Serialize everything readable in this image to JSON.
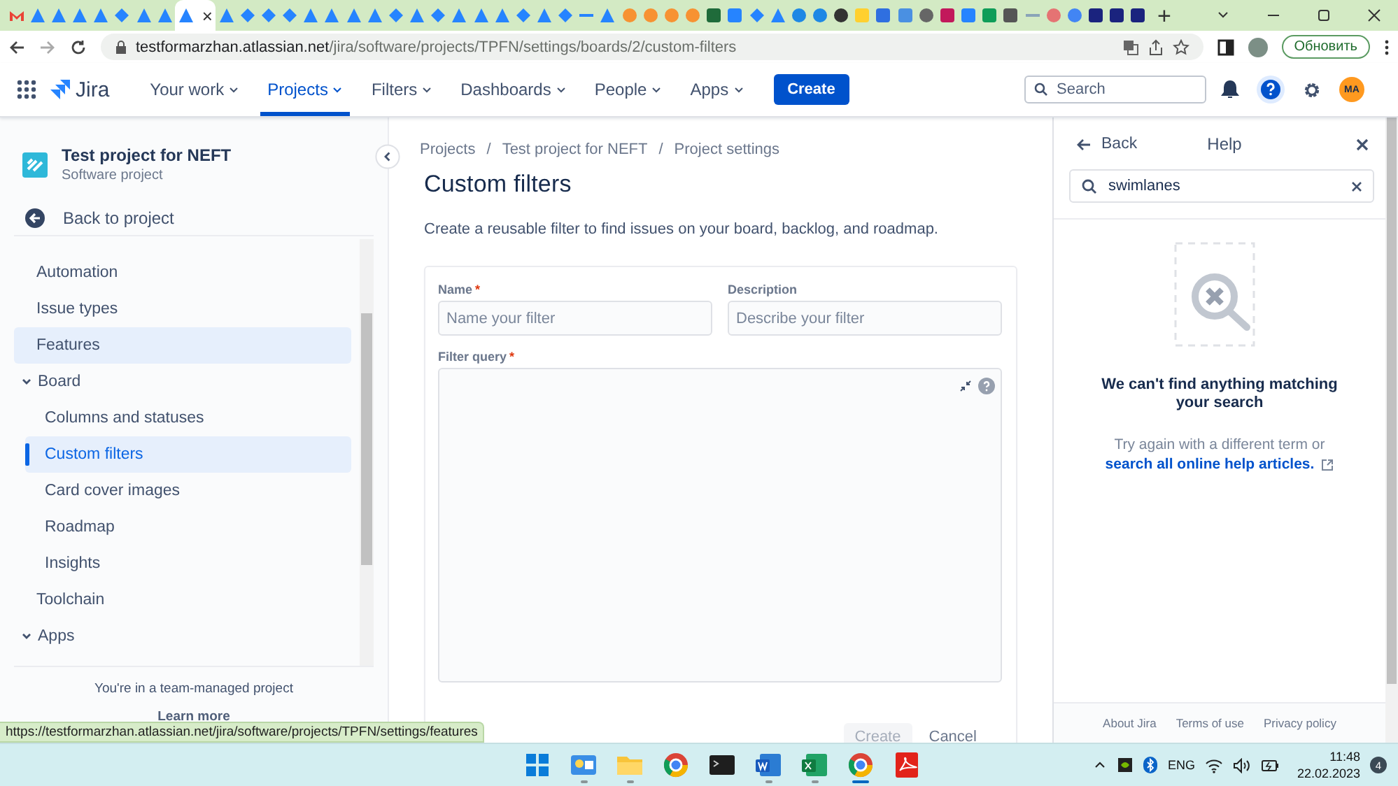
{
  "browser": {
    "tabs": [
      {
        "kind": "gmail",
        "color": "#ea4335",
        "selected": false
      },
      {
        "kind": "triangle",
        "color": "#2684ff",
        "selected": false
      },
      {
        "kind": "triangle",
        "color": "#2684ff",
        "selected": false
      },
      {
        "kind": "triangle",
        "color": "#2684ff",
        "selected": false
      },
      {
        "kind": "triangle",
        "color": "#2684ff",
        "selected": false
      },
      {
        "kind": "arrows",
        "color": "#2684ff",
        "selected": false
      },
      {
        "kind": "triangle",
        "color": "#2684ff",
        "selected": false
      },
      {
        "kind": "triangle",
        "color": "#2684ff",
        "selected": false
      },
      {
        "kind": "triangle",
        "color": "#2684ff",
        "selected": true,
        "close": "×"
      },
      {
        "kind": "triangle",
        "color": "#2684ff",
        "selected": false
      },
      {
        "kind": "arrows",
        "color": "#2684ff",
        "selected": false
      },
      {
        "kind": "arrows",
        "color": "#2684ff",
        "selected": false
      },
      {
        "kind": "arrows",
        "color": "#2684ff",
        "selected": false
      },
      {
        "kind": "triangle",
        "color": "#2684ff",
        "selected": false
      },
      {
        "kind": "triangle",
        "color": "#2684ff",
        "selected": false
      },
      {
        "kind": "triangle",
        "color": "#2684ff",
        "selected": false
      },
      {
        "kind": "triangle",
        "color": "#2684ff",
        "selected": false
      },
      {
        "kind": "arrows",
        "color": "#2684ff",
        "selected": false
      },
      {
        "kind": "triangle",
        "color": "#2684ff",
        "selected": false
      },
      {
        "kind": "arrows",
        "color": "#2684ff",
        "selected": false
      },
      {
        "kind": "triangle",
        "color": "#2684ff",
        "selected": false
      },
      {
        "kind": "triangle",
        "color": "#2684ff",
        "selected": false
      },
      {
        "kind": "triangle",
        "color": "#2684ff",
        "selected": false
      },
      {
        "kind": "arrows",
        "color": "#2684ff",
        "selected": false
      },
      {
        "kind": "triangle",
        "color": "#2684ff",
        "selected": false
      },
      {
        "kind": "arrows",
        "color": "#2684ff",
        "selected": false
      },
      {
        "kind": "line",
        "color": "#2684ff",
        "selected": false
      },
      {
        "kind": "triangle",
        "color": "#2684ff",
        "selected": false
      },
      {
        "kind": "circle",
        "color": "#f79232",
        "selected": false
      },
      {
        "kind": "circle",
        "color": "#f79232",
        "selected": false
      },
      {
        "kind": "circle",
        "color": "#f79232",
        "selected": false
      },
      {
        "kind": "circle",
        "color": "#f79232",
        "selected": false
      },
      {
        "kind": "square",
        "color": "#1f6b3a",
        "selected": false
      },
      {
        "kind": "square",
        "color": "#2684ff",
        "selected": false
      },
      {
        "kind": "arrows",
        "color": "#2684ff",
        "selected": false
      },
      {
        "kind": "triangle",
        "color": "#2684ff",
        "selected": false
      },
      {
        "kind": "circle",
        "color": "#1e88e5",
        "selected": false
      },
      {
        "kind": "circle",
        "color": "#1e88e5",
        "selected": false
      },
      {
        "kind": "circle",
        "color": "#333333",
        "selected": false
      },
      {
        "kind": "square",
        "color": "#ffd02f",
        "selected": false
      },
      {
        "kind": "square",
        "color": "#2f6fe0",
        "selected": false
      },
      {
        "kind": "square",
        "color": "#4a90e2",
        "selected": false
      },
      {
        "kind": "circle",
        "color": "#666666",
        "selected": false
      },
      {
        "kind": "square",
        "color": "#c2185b",
        "selected": false
      },
      {
        "kind": "square",
        "color": "#2684ff",
        "selected": false
      },
      {
        "kind": "square",
        "color": "#0f9d58",
        "selected": false
      },
      {
        "kind": "square",
        "color": "#555555",
        "selected": false
      },
      {
        "kind": "line",
        "color": "#8aa4b8",
        "selected": false
      },
      {
        "kind": "circle",
        "color": "#e57373",
        "selected": false
      },
      {
        "kind": "circle",
        "color": "#4285f4",
        "selected": false
      },
      {
        "kind": "square",
        "color": "#1a237e",
        "selected": false
      },
      {
        "kind": "square",
        "color": "#1a237e",
        "selected": false
      },
      {
        "kind": "square",
        "color": "#1a237e",
        "selected": false
      }
    ],
    "new_tab": "+",
    "url_host": "testformarzhan.atlassian.net",
    "url_path": "/jira/software/projects/TPFN/settings/boards/2/custom-filters",
    "update_button": "Обновить",
    "status_url": "https://testformarzhan.atlassian.net/jira/software/projects/TPFN/settings/features"
  },
  "nav": {
    "product": "Jira",
    "menu": [
      {
        "label": "Your work",
        "selected": false
      },
      {
        "label": "Projects",
        "selected": true
      },
      {
        "label": "Filters",
        "selected": false
      },
      {
        "label": "Dashboards",
        "selected": false
      },
      {
        "label": "People",
        "selected": false
      },
      {
        "label": "Apps",
        "selected": false
      }
    ],
    "create": "Create",
    "search_placeholder": "Search",
    "help_open": true,
    "avatar": "MA"
  },
  "sidebar": {
    "project_name": "Test project for NEFT",
    "project_type": "Software project",
    "back": "Back to project",
    "items": [
      {
        "label": "Automation",
        "selected": false,
        "highlighted": false
      },
      {
        "label": "Issue types",
        "selected": false,
        "highlighted": false
      },
      {
        "label": "Features",
        "selected": false,
        "highlighted": true
      },
      {
        "label": "Board",
        "selected": false,
        "highlighted": false,
        "expanded": true,
        "children": [
          {
            "label": "Columns and statuses",
            "selected": false,
            "highlighted": false
          },
          {
            "label": "Custom filters",
            "selected": true,
            "highlighted": false
          },
          {
            "label": "Card cover images",
            "selected": false,
            "highlighted": false
          },
          {
            "label": "Roadmap",
            "selected": false,
            "highlighted": false
          },
          {
            "label": "Insights",
            "selected": false,
            "highlighted": false
          }
        ]
      },
      {
        "label": "Toolchain",
        "selected": false,
        "highlighted": false
      },
      {
        "label": "Apps",
        "selected": false,
        "highlighted": false,
        "expanded": true
      }
    ],
    "footer_note": "You're in a team-managed project",
    "footer_link": "Learn more"
  },
  "main": {
    "breadcrumbs": [
      "Projects",
      "Test project for NEFT",
      "Project settings"
    ],
    "breadcrumb_separator": "/",
    "title": "Custom filters",
    "description": "Create a reusable filter to find issues on your board, backlog, and roadmap.",
    "fields": [
      {
        "kind": "input",
        "label": "Name",
        "required": "*",
        "placeholder": "Name your filter"
      },
      {
        "kind": "input",
        "label": "Description",
        "placeholder": "Describe your filter"
      },
      {
        "kind": "query",
        "label": "Filter query",
        "required": "*"
      }
    ],
    "buttons": [
      {
        "label": "Create",
        "kind": "primary",
        "disabled": true
      },
      {
        "label": "Cancel",
        "kind": "subtle",
        "disabled": false
      }
    ]
  },
  "help": {
    "back": "Back",
    "title": "Help",
    "search_value": "swimlanes",
    "empty_title": "We can't find anything matching your search",
    "empty_text": "Try again with a different term or",
    "empty_link": "search all online help articles.",
    "footer_links": [
      "About Jira",
      "Terms of use",
      "Privacy policy"
    ]
  },
  "taskbar": {
    "apps": [
      {
        "kind": "start",
        "running": false,
        "selected": false
      },
      {
        "kind": "widgets",
        "running": true,
        "selected": false
      },
      {
        "kind": "explorer",
        "running": true,
        "selected": false
      },
      {
        "kind": "chrome",
        "running": false,
        "selected": false
      },
      {
        "kind": "terminal",
        "running": false,
        "selected": false
      },
      {
        "kind": "word",
        "running": true,
        "selected": false
      },
      {
        "kind": "excel",
        "running": true,
        "selected": false
      },
      {
        "kind": "chrome",
        "running": true,
        "selected": true
      },
      {
        "kind": "pdf",
        "running": false,
        "selected": false
      }
    ],
    "language": "ENG",
    "time": "11:48",
    "date": "22.02.2023",
    "notifications": "4"
  }
}
